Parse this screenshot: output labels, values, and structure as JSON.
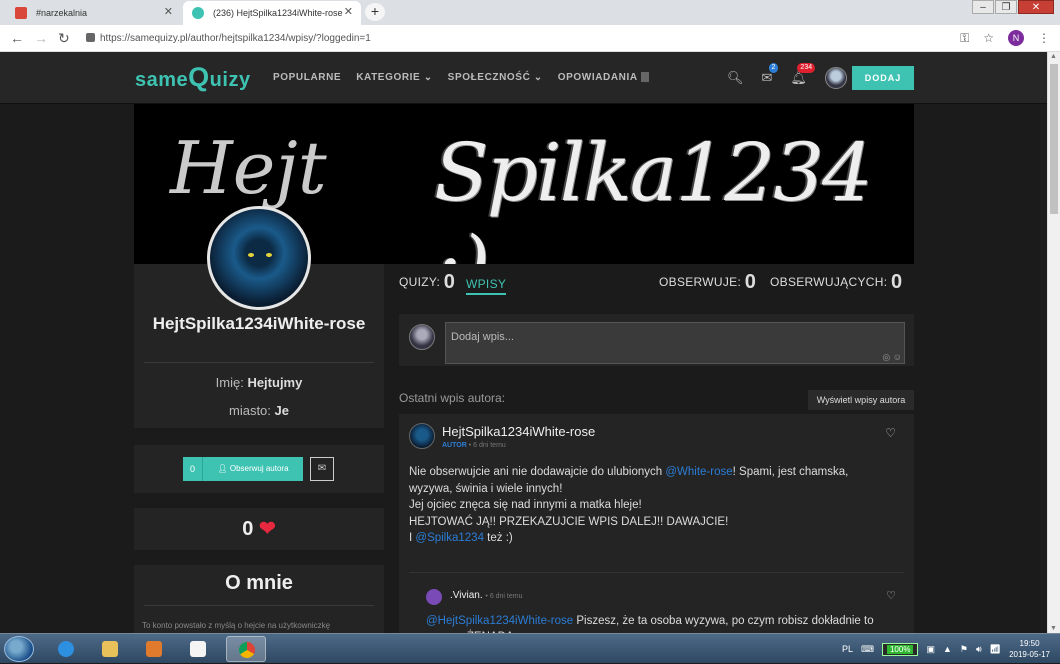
{
  "browser": {
    "tabs": [
      {
        "title": "#narzekalnia",
        "active": false
      },
      {
        "title": "(236) HejtSpilka1234iWhite-rose",
        "active": true
      }
    ],
    "url": "https://samequizy.pl/author/hejtspilka1234/wpisy/?loggedin=1",
    "profile_initial": "N"
  },
  "nav": {
    "logo_small": "same",
    "logo_big": "Q",
    "logo_rest": "uizy",
    "menu": [
      "POPULARNE",
      "KATEGORIE",
      "SPOŁECZNOŚĆ",
      "OPOWIADANIA"
    ],
    "messages_badge": "2",
    "notifications_badge": "234",
    "add_button": "DODAJ",
    "accent": "#3ec3b2"
  },
  "banner": {
    "left_text": "Hejt",
    "right_text": "Spilka1234 :)"
  },
  "profile": {
    "username": "HejtSpilka1234iWhite-rose",
    "name_label": "Imię:",
    "name_value": "Hejtujmy",
    "city_label": "miasto:",
    "city_value": "Je",
    "followers_count": "0",
    "follow_label": "Obserwuj autora",
    "likes": "0",
    "about_title": "O mnie",
    "about_text": "To konto powstało z myślą o hejcie na użytkowniczkę"
  },
  "stats": {
    "quizy_label": "QUIZY:",
    "quizy_value": "0",
    "wpisy_label": "WPISY",
    "obserwuje_label": "OBSERWUJE:",
    "obserwuje_value": "0",
    "obserwujacych_label": "OBSERWUJĄCYCH:",
    "obserwujacych_value": "0"
  },
  "compose": {
    "placeholder": "Dodaj wpis..."
  },
  "feed": {
    "last_label": "Ostatni wpis autora:",
    "show_button": "Wyświetl wpisy autora",
    "post": {
      "author": "HejtSpilka1234iWhite-rose",
      "role": "AUTOR",
      "time": "6 dni temu",
      "line1_a": "Nie obserwujcie ani nie dodawajcie do ulubionych ",
      "line1_mention": "@White-rose",
      "line1_b": "! Spami, jest chamska, wyzywa, świnia i wiele innych!",
      "line2": "Jej ojciec znęca się nad innymi a matka hleje!",
      "line3": "HEJTOWAĆ JĄ!! PRZEKAZUJCIE WPIS DALEJ!! DAWAJCIE!",
      "line4_a": "I ",
      "line4_mention": "@Spilka1234",
      "line4_b": " też :)"
    },
    "reply": {
      "author": ".Vivian.",
      "time": "6 dni temu",
      "mention": "@HejtSpilka1234iWhite-rose",
      "text": " Piszesz, że ta osoba wyzywa, po czym robisz dokładnie to samo... ŻENADA"
    }
  },
  "taskbar": {
    "lang": "PL",
    "battery": "100%",
    "time": "19:50",
    "date": "2019-05-17"
  }
}
